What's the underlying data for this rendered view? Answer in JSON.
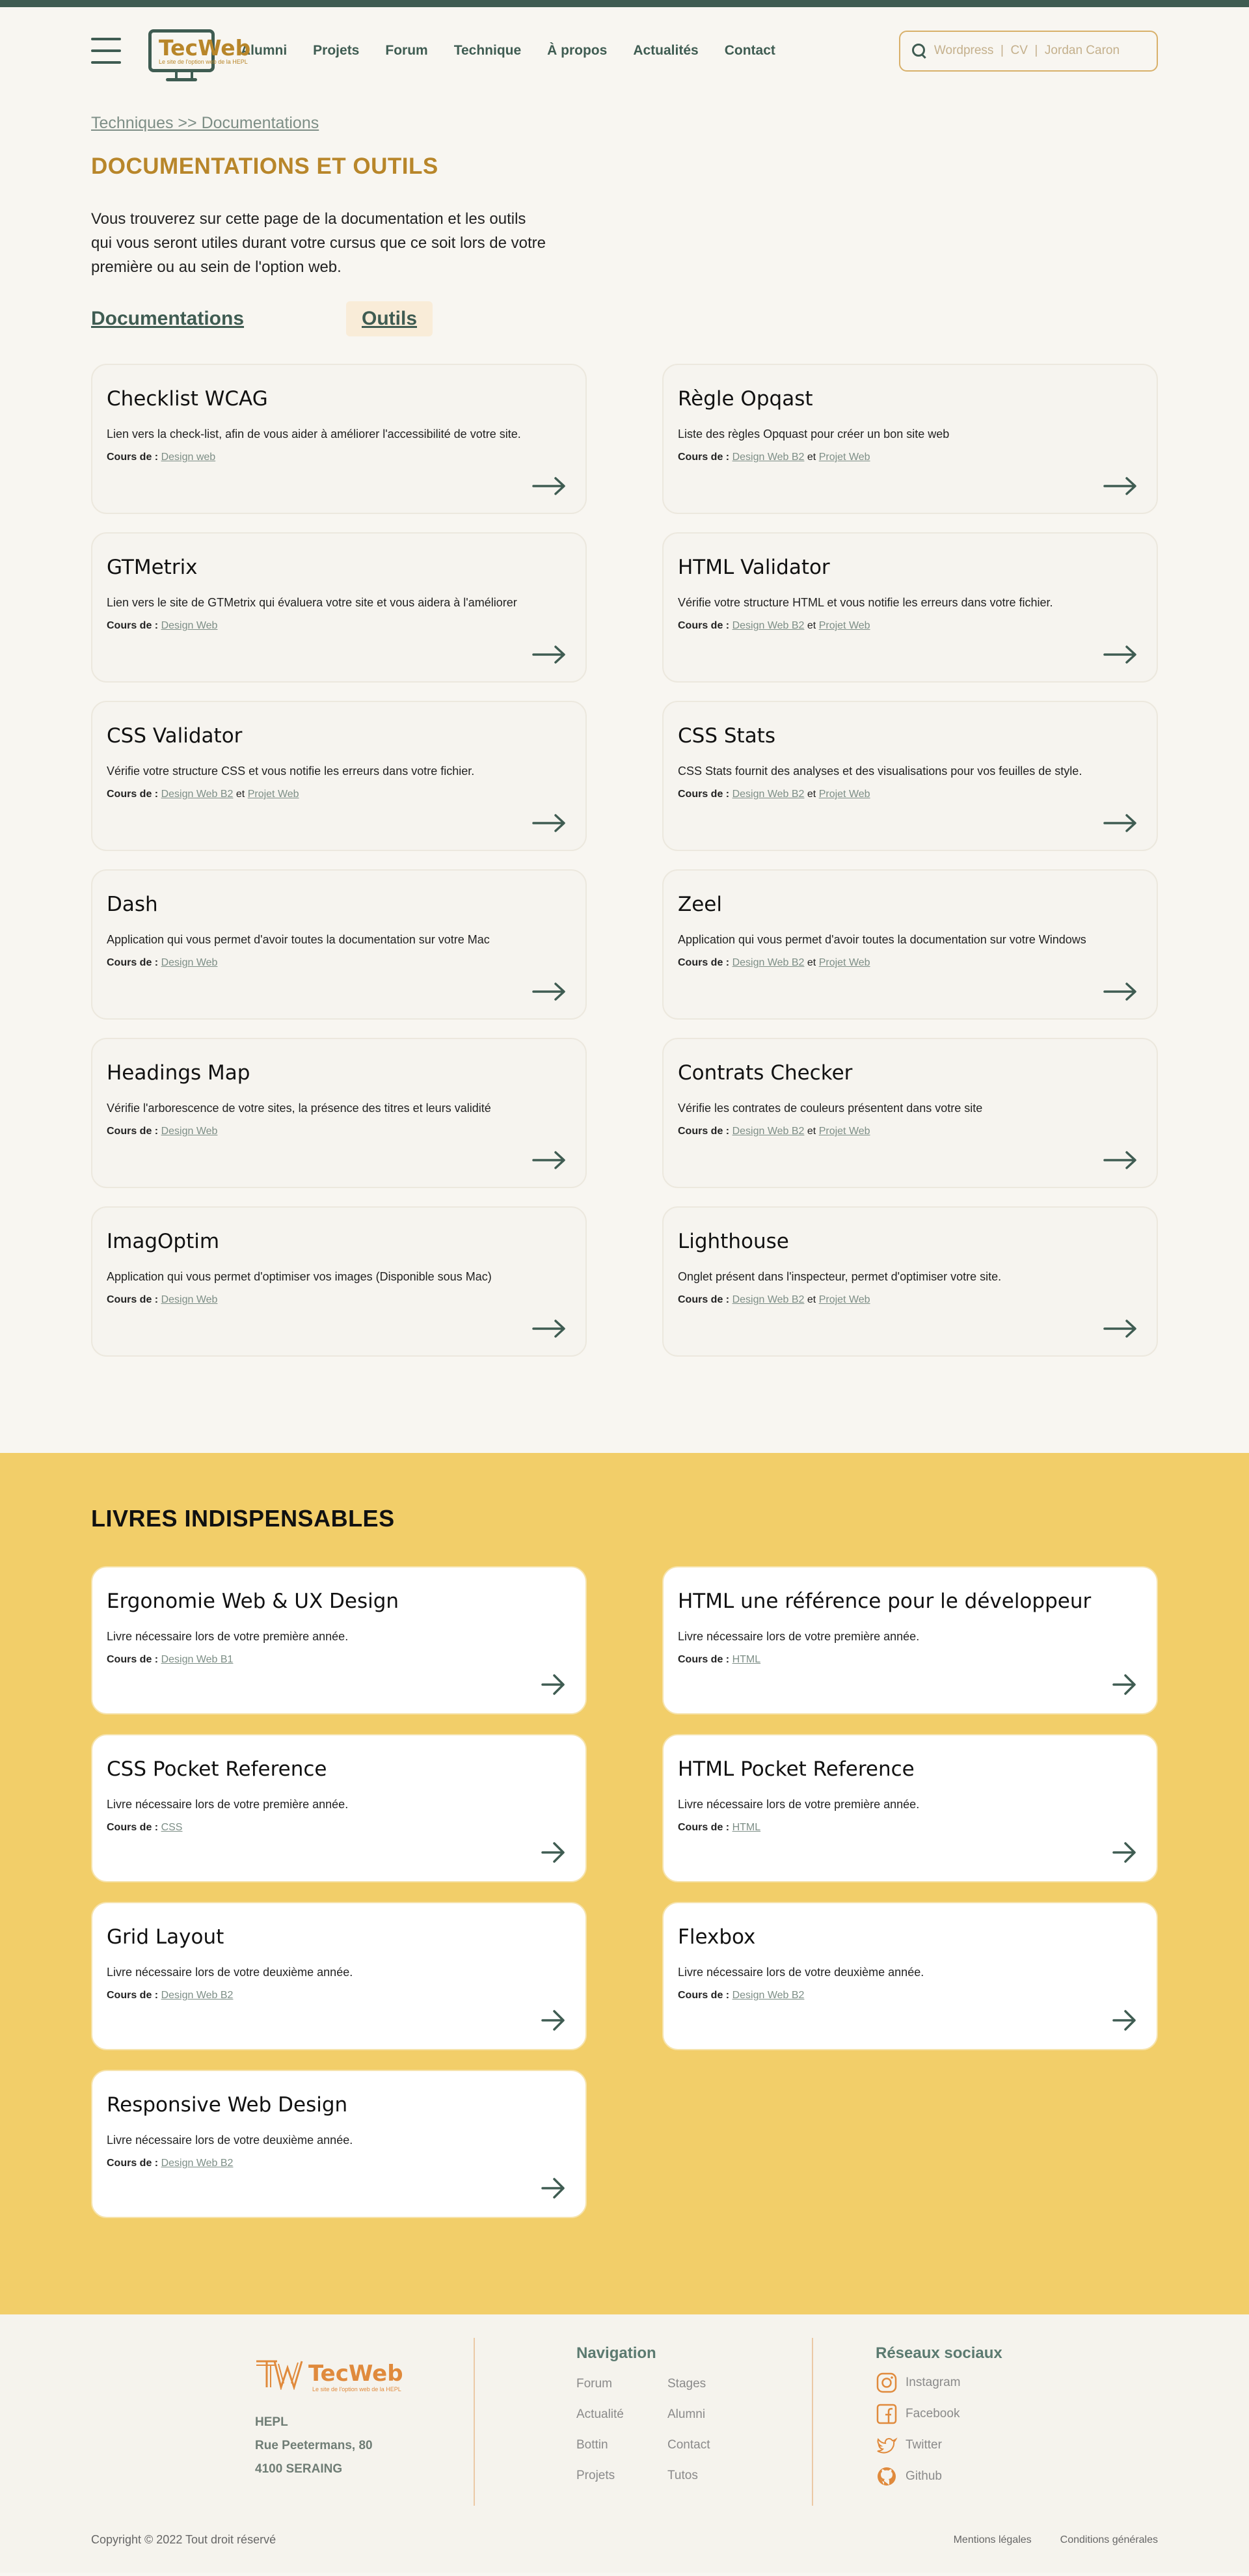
{
  "header": {
    "logo_name": "TecWeb",
    "logo_sub": "Le site de l'option web de la HEPL",
    "nav": [
      "Alumni",
      "Projets",
      "Forum",
      "Technique",
      "À propos",
      "Actualités",
      "Contact"
    ],
    "search_placeholder": "Wordpress  |  CV  |  Jordan Caron"
  },
  "breadcrumb": "Techniques >> Documentations",
  "page_title": "DOCUMENTATIONS ET OUTILS",
  "intro": "Vous trouverez sur cette page de la documentation et les outils qui vous seront utiles durant votre cursus que ce soit lors de votre première ou au sein de l'option web.",
  "tabs": {
    "docs": "Documentations",
    "tools": "Outils"
  },
  "course_label": "Cours de :",
  "and_word": "et",
  "tools": [
    {
      "title": "Checklist WCAG",
      "desc": "Lien vers la check-list, afin de vous aider à améliorer l'accessibilité de votre site.",
      "course1": "Design web",
      "course2": ""
    },
    {
      "title": "Règle Opqast",
      "desc": "Liste des règles Opquast pour créer un bon site web",
      "course1": "Design Web B2",
      "course2": "Projet Web"
    },
    {
      "title": "GTMetrix",
      "desc": "Lien vers le site de GTMetrix qui évaluera votre site et vous aidera à l'améliorer",
      "course1": "Design Web",
      "course2": ""
    },
    {
      "title": "HTML Validator",
      "desc": "Vérifie votre structure HTML et vous notifie les erreurs dans votre fichier.",
      "course1": "Design Web B2",
      "course2": "Projet Web"
    },
    {
      "title": "CSS Validator",
      "desc": "Vérifie votre structure CSS et vous notifie les erreurs dans votre fichier.",
      "course1": "Design Web B2",
      "course2": "Projet Web"
    },
    {
      "title": "CSS Stats",
      "desc": "CSS Stats fournit des analyses et des visualisations pour vos feuilles de style.",
      "course1": "Design Web B2",
      "course2": "Projet Web"
    },
    {
      "title": "Dash",
      "desc": "Application qui vous permet d'avoir toutes la documentation sur votre Mac",
      "course1": "Design Web",
      "course2": ""
    },
    {
      "title": "Zeel",
      "desc": "Application qui vous permet d'avoir toutes la documentation sur votre Windows",
      "course1": "Design Web B2",
      "course2": "Projet Web"
    },
    {
      "title": "Headings Map",
      "desc": "Vérifie l'arborescence de votre sites, la présence des titres et leurs validité",
      "course1": "Design Web",
      "course2": ""
    },
    {
      "title": "Contrats Checker",
      "desc": "Vérifie les contrates de couleurs présentent dans votre site",
      "course1": "Design Web B2",
      "course2": "Projet Web"
    },
    {
      "title": "ImagOptim",
      "desc": "Application qui vous permet d'optimiser vos images (Disponible sous Mac)",
      "course1": "Design Web",
      "course2": ""
    },
    {
      "title": "Lighthouse",
      "desc": "Onglet présent dans l'inspecteur, permet d'optimiser votre site.",
      "course1": "Design Web B2",
      "course2": "Projet Web"
    }
  ],
  "books_title": "LIVRES INDISPENSABLES",
  "books": [
    {
      "title": "Ergonomie Web & UX Design",
      "desc": "Livre nécessaire lors de votre première année.",
      "course1": "Design Web B1"
    },
    {
      "title": "HTML une référence pour le développeur",
      "desc": "Livre nécessaire lors de votre première année.",
      "course1": "HTML"
    },
    {
      "title": "CSS Pocket Reference",
      "desc": "Livre nécessaire lors de votre première année.",
      "course1": "CSS"
    },
    {
      "title": "HTML Pocket Reference",
      "desc": "Livre nécessaire lors de votre première année.",
      "course1": "HTML"
    },
    {
      "title": "Grid Layout",
      "desc": "Livre nécessaire lors de votre deuxième année.",
      "course1": "Design Web B2"
    },
    {
      "title": "Flexbox",
      "desc": "Livre nécessaire lors de votre deuxième année.",
      "course1": "Design Web B2"
    },
    {
      "title": "Responsive Web Design",
      "desc": "Livre nécessaire lors de votre deuxième année.",
      "course1": "Design Web B2"
    }
  ],
  "footer": {
    "logo_name": "TecWeb",
    "logo_sub": "Le site de l'option web de la HEPL",
    "address": [
      "HEPL",
      "Rue Peetermans, 80",
      "4100 SERAING"
    ],
    "nav_title": "Navigation",
    "nav_links": [
      "Forum",
      "Stages",
      "Actualité",
      "Alumni",
      "Bottin",
      "Contact",
      "Projets",
      "Tutos"
    ],
    "social_title": "Réseaux sociaux",
    "social": [
      "Instagram",
      "Facebook",
      "Twitter",
      "Github"
    ],
    "copyright": "Copyright © 2022 Tout droit réservé",
    "legal": [
      "Mentions légales",
      "Conditions générales"
    ]
  },
  "colors": {
    "primary_green": "#3f5c52",
    "gold": "#b8862a",
    "books_bg": "#f2ce69",
    "footer_orange": "#e08a3c"
  }
}
